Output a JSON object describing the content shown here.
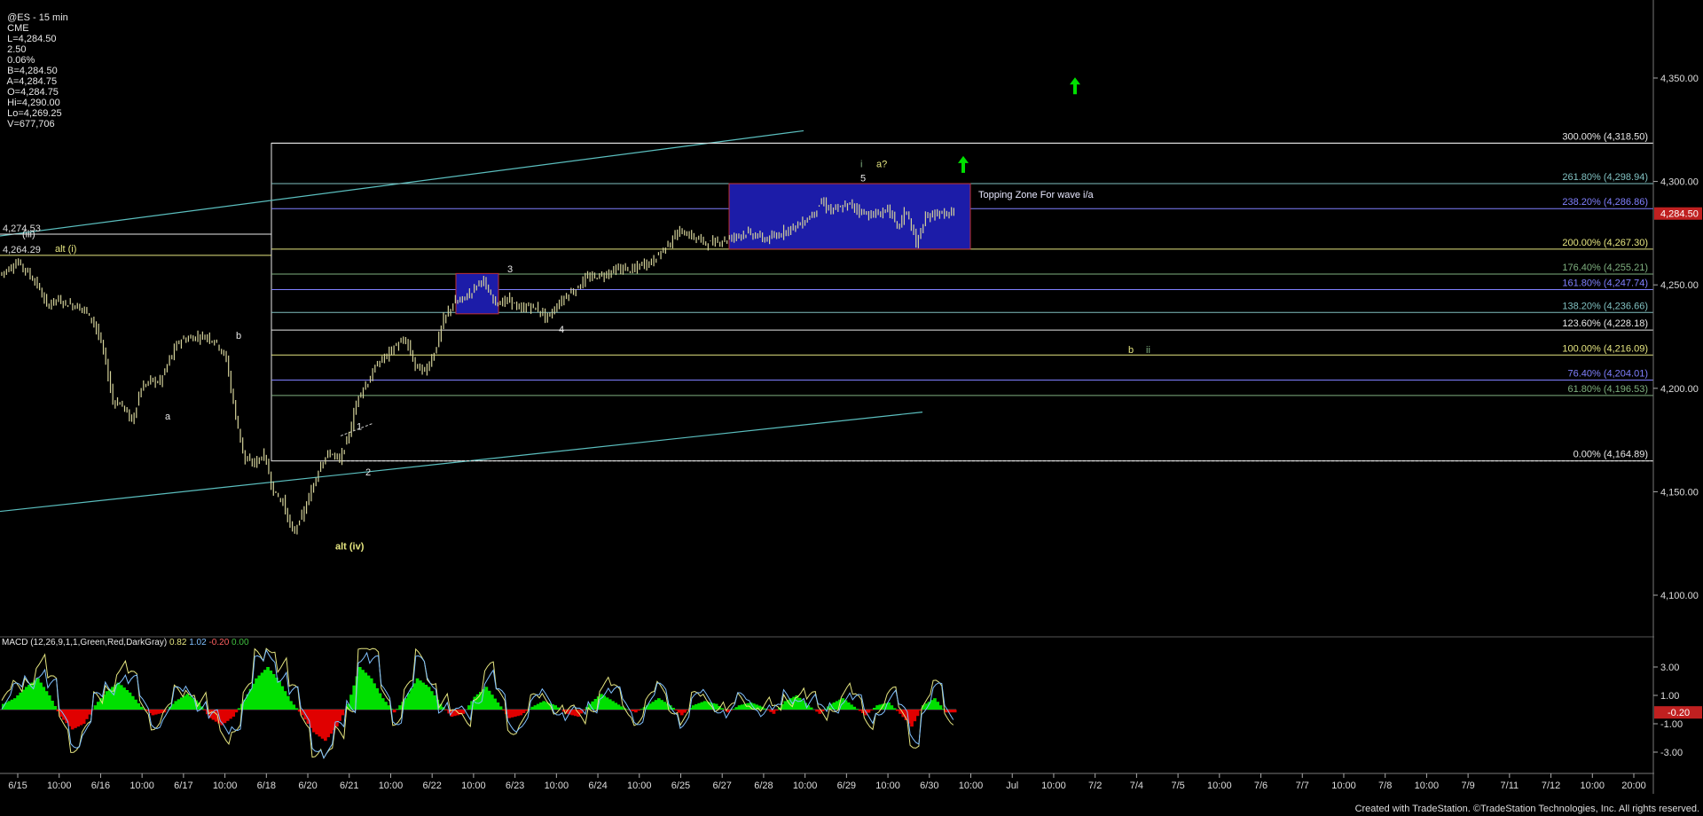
{
  "header": {
    "symbol": "@ES - 15 min",
    "exchange": "CME",
    "last": "L=4,284.50",
    "change": "2.50",
    "change_pct": "0.06%",
    "bid": "B=4,284.50",
    "ask": "A=4,284.75",
    "open": "O=4,284.75",
    "high": "Hi=4,290.00",
    "low": "Lo=4,269.25",
    "volume": "V=677,706"
  },
  "macd_header": {
    "label": "MACD (12,26,9,1,1,Green,Red,DarkGray)",
    "v1": "0.82",
    "v2": "1.02",
    "v3": "-0.20",
    "v4": "0.00"
  },
  "footer": "Created with TradeStation. ©TradeStation Technologies, Inc. All rights reserved.",
  "colors": {
    "background": "#000000",
    "price_bar": "#d4d29a",
    "fib_white": "#e8e8e8",
    "fib_yellow": "#e6e680",
    "fib_blue": "#8080ff",
    "fib_green": "#7fb07f",
    "fib_teal": "#80c0c0",
    "channel": "#5bbfbf",
    "zone_fill": "#1c1ca8",
    "zone_border": "#c03030",
    "macd_up": "#00e000",
    "macd_down": "#e00000",
    "arrow": "#00e000"
  },
  "chart_data": {
    "type": "candlestick",
    "title": "",
    "price_axis": {
      "range": [
        4082,
        4380
      ],
      "ticks": [
        "4,350.00",
        "4,300.00",
        "4,250.00",
        "4,200.00",
        "4,150.00",
        "4,100.00"
      ],
      "tick_values": [
        4350,
        4300,
        4250,
        4200,
        4150,
        4100
      ],
      "last_price": "4,284.50"
    },
    "time_axis": {
      "labels": [
        "6/15",
        "10:00",
        "6/16",
        "10:00",
        "6/17",
        "10:00",
        "6/18",
        "6/20",
        "6/21",
        "10:00",
        "6/22",
        "10:00",
        "6/23",
        "10:00",
        "6/24",
        "10:00",
        "6/25",
        "6/27",
        "6/28",
        "10:00",
        "6/29",
        "10:00",
        "6/30",
        "10:00",
        "Jul",
        "10:00",
        "7/2",
        "7/4",
        "7/5",
        "10:00",
        "7/6",
        "7/7",
        "10:00",
        "7/8",
        "10:00",
        "7/9",
        "7/11",
        "7/12",
        "10:00",
        "20:00"
      ]
    },
    "price_path": [
      4255,
      4258,
      4261,
      4256,
      4250,
      4240,
      4243,
      4241,
      4240,
      4238,
      4232,
      4218,
      4194,
      4192,
      4184,
      4200,
      4204,
      4203,
      4214,
      4223,
      4224,
      4225,
      4225,
      4222,
      4214,
      4186,
      4165,
      4164,
      4168,
      4150,
      4145,
      4130,
      4138,
      4150,
      4164,
      4169,
      4165,
      4178,
      4197,
      4203,
      4212,
      4216,
      4221,
      4223,
      4211,
      4208,
      4217,
      4233,
      4241,
      4243,
      4247,
      4253,
      4244,
      4241,
      4243,
      4238,
      4240,
      4238,
      4234,
      4240,
      4245,
      4248,
      4253,
      4254,
      4255,
      4257,
      4258,
      4257,
      4260,
      4261,
      4266,
      4271,
      4276,
      4274,
      4272,
      4270,
      4271,
      4272,
      4274,
      4275,
      4274,
      4272,
      4273,
      4276,
      4278,
      4280,
      4284,
      4290,
      4286,
      4287,
      4289,
      4286,
      4284,
      4284,
      4287,
      4278,
      4286,
      4270,
      4282,
      4285,
      4284,
      4284.5
    ],
    "fib_levels": [
      {
        "pct": "300.00%",
        "label": "300.00% (4,318.50)",
        "value": 4318.5,
        "color": "white"
      },
      {
        "pct": "261.80%",
        "label": "261.80% (4,298.94)",
        "value": 4298.94,
        "color": "teal"
      },
      {
        "pct": "238.20%",
        "label": "238.20% (4,286.86)",
        "value": 4286.86,
        "color": "blue"
      },
      {
        "pct": "200.00%",
        "label": "200.00% (4,267.30)",
        "value": 4267.3,
        "color": "yellow"
      },
      {
        "pct": "176.40%",
        "label": "176.40% (4,255.21)",
        "value": 4255.21,
        "color": "green"
      },
      {
        "pct": "161.80%",
        "label": "161.80% (4,247.74)",
        "value": 4247.74,
        "color": "blue"
      },
      {
        "pct": "138.20%",
        "label": "138.20% (4,236.66)",
        "value": 4236.66,
        "color": "teal"
      },
      {
        "pct": "123.60%",
        "label": "123.60% (4,228.18)",
        "value": 4228.18,
        "color": "white"
      },
      {
        "pct": "100.00%",
        "label": "100.00% (4,216.09)",
        "value": 4216.09,
        "color": "yellow"
      },
      {
        "pct": "76.40%",
        "label": "76.40% (4,204.01)",
        "value": 4204.01,
        "color": "blue"
      },
      {
        "pct": "61.80%",
        "label": "61.80% (4,196.53)",
        "value": 4196.53,
        "color": "green"
      },
      {
        "pct": "0.00%",
        "label": "0.00% (4,164.89)",
        "value": 4164.89,
        "color": "white"
      }
    ],
    "left_levels": [
      {
        "label": "4,274.53",
        "value": 4274.53
      },
      {
        "label": "4,264.29",
        "value": 4264.29
      }
    ],
    "zone_label": "Topping Zone For wave i/a",
    "wave_labels": [
      {
        "text": "(iii)",
        "price": 4273,
        "color": "white"
      },
      {
        "text": "alt (i)",
        "price": 4266,
        "color": "yellow"
      },
      {
        "text": "a",
        "price": 4185,
        "color": "white"
      },
      {
        "text": "b",
        "price": 4224,
        "color": "white"
      },
      {
        "text": "1",
        "price": 4180,
        "color": "white"
      },
      {
        "text": "2",
        "price": 4158,
        "color": "white"
      },
      {
        "text": "alt (iv)",
        "price": 4122,
        "color": "yellow"
      },
      {
        "text": "3",
        "price": 4256,
        "color": "white"
      },
      {
        "text": "4",
        "price": 4227,
        "color": "white"
      },
      {
        "text": "5",
        "price": 4300,
        "color": "white"
      },
      {
        "text": "i",
        "price": 4307,
        "color": "green"
      },
      {
        "text": "a?",
        "price": 4307,
        "color": "yellow"
      },
      {
        "text": "b",
        "price": 4217,
        "color": "yellow"
      },
      {
        "text": "ii",
        "price": 4217,
        "color": "green"
      }
    ],
    "macd": {
      "ticks": [
        "3.00",
        "1.00",
        "-1.00",
        "-3.00"
      ],
      "tick_values": [
        3,
        1,
        -1,
        -3
      ],
      "last": "-0.20",
      "hist": [
        0.4,
        0.8,
        1.6,
        2.2,
        1.0,
        -0.5,
        -1.4,
        -1.0,
        0.3,
        1.3,
        1.9,
        1.2,
        0.2,
        -0.4,
        -0.2,
        0.6,
        1.1,
        0.5,
        -0.6,
        -1.1,
        -0.5,
        0.7,
        2.2,
        3.0,
        2.0,
        0.6,
        -0.4,
        -1.6,
        -2.2,
        -1.2,
        0.4,
        3.0,
        2.2,
        0.8,
        -0.2,
        0.8,
        2.2,
        1.6,
        0.4,
        -0.5,
        -0.3,
        0.9,
        1.6,
        0.5,
        -0.6,
        -0.4,
        0.2,
        0.6,
        0.3,
        -0.3,
        -0.5,
        0.4,
        1.1,
        0.6,
        0.1,
        -0.2,
        0.3,
        0.8,
        0.3,
        -0.4,
        0.3,
        0.6,
        0.4,
        -0.2,
        0.3,
        0.5,
        0.2,
        -0.3,
        0.6,
        1.0,
        0.3,
        -0.3,
        0.4,
        0.8,
        0.2,
        -0.4,
        0.3,
        0.5,
        -0.3,
        -1.2,
        0.3,
        0.8,
        -0.2
      ]
    }
  }
}
